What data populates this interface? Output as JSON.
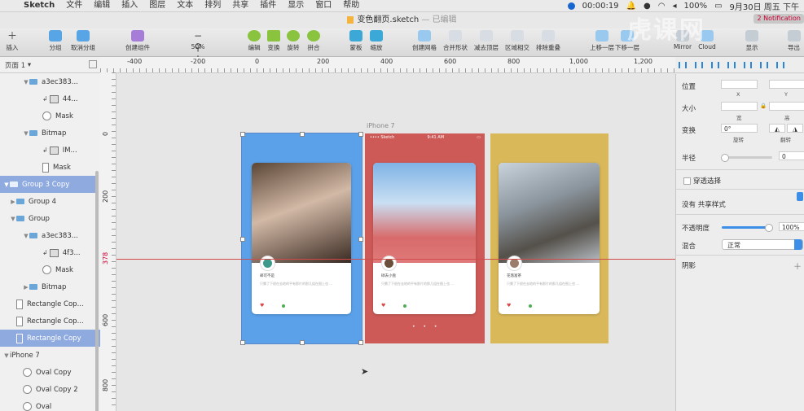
{
  "menubar": {
    "app": "Sketch",
    "items": [
      "文件",
      "编辑",
      "插入",
      "图层",
      "文本",
      "排列",
      "共享",
      "插件",
      "显示",
      "窗口",
      "帮助"
    ],
    "timer": "00:00:19",
    "battery": "100%",
    "date": "9月30日 周五 下午"
  },
  "window": {
    "title": "变色翻页.sketch",
    "edited": "— 已编辑",
    "notifications": "2 Notification"
  },
  "toolbar": {
    "insert": "插入",
    "group": "分组",
    "ungroup": "取消分组",
    "create_symbol": "创建组件",
    "zoom": "50%",
    "edit": "编辑",
    "transform": "变换",
    "rotate": "旋转",
    "flatten": "拼合",
    "mask": "蒙板",
    "scale": "缩放",
    "create_grid": "创建网格",
    "union": "合并形状",
    "subtract": "减去顶层",
    "intersect": "区域相交",
    "difference": "排除重叠",
    "forward": "上移一层",
    "backward": "下移一层",
    "mirror": "Mirror",
    "cloud": "Cloud",
    "view": "显示",
    "export": "导出"
  },
  "sidebar": {
    "page": "页面 1",
    "layers": [
      {
        "label": "a3ec383...",
        "icon": "folder-icon",
        "indent": 3,
        "arrow": "▼",
        "selected": false
      },
      {
        "label": "44...",
        "icon": "image-icon",
        "indent": 5,
        "arrow": "",
        "selected": false
      },
      {
        "label": "Mask",
        "icon": "oval-icon",
        "indent": 5,
        "arrow": "",
        "selected": false
      },
      {
        "label": "Bitmap",
        "icon": "folder-icon",
        "indent": 3,
        "arrow": "▼",
        "selected": false
      },
      {
        "label": "IM...",
        "icon": "image-icon",
        "indent": 5,
        "arrow": "",
        "selected": false
      },
      {
        "label": "Mask",
        "icon": "rect-icon",
        "indent": 5,
        "arrow": "",
        "selected": false
      },
      {
        "label": "Group 3 Copy",
        "icon": "folder-icon",
        "indent": 0,
        "arrow": "▼",
        "selected": true
      },
      {
        "label": "Group 4",
        "icon": "folder-icon",
        "indent": 1,
        "arrow": "▶",
        "selected": false
      },
      {
        "label": "Group",
        "icon": "folder-icon",
        "indent": 1,
        "arrow": "▼",
        "selected": false
      },
      {
        "label": "a3ec383...",
        "icon": "folder-icon",
        "indent": 3,
        "arrow": "▼",
        "selected": false
      },
      {
        "label": "4f3...",
        "icon": "image-icon",
        "indent": 5,
        "arrow": "",
        "selected": false
      },
      {
        "label": "Mask",
        "icon": "oval-icon",
        "indent": 5,
        "arrow": "",
        "selected": false
      },
      {
        "label": "Bitmap",
        "icon": "folder-icon",
        "indent": 3,
        "arrow": "▶",
        "selected": false
      },
      {
        "label": "Rectangle Cop...",
        "icon": "rect-icon",
        "indent": 1,
        "arrow": "",
        "selected": false
      },
      {
        "label": "Rectangle Cop...",
        "icon": "rect-icon",
        "indent": 1,
        "arrow": "",
        "selected": false
      },
      {
        "label": "Rectangle Copy",
        "icon": "rect-icon",
        "indent": 1,
        "arrow": "",
        "selected": true
      },
      {
        "label": "iPhone 7",
        "icon": "",
        "indent": 0,
        "arrow": "▼",
        "selected": false
      },
      {
        "label": "Oval Copy",
        "icon": "oval-icon",
        "indent": 2,
        "arrow": "",
        "selected": false
      },
      {
        "label": "Oval Copy 2",
        "icon": "oval-icon",
        "indent": 2,
        "arrow": "",
        "selected": false
      },
      {
        "label": "Oval",
        "icon": "oval-icon",
        "indent": 2,
        "arrow": "",
        "selected": false
      }
    ]
  },
  "rulers": {
    "h": [
      "-400",
      "-200",
      "0",
      "200",
      "400",
      "600",
      "800",
      "1,000",
      "1,200"
    ],
    "v": [
      "0",
      "200",
      "378",
      "600",
      "800"
    ]
  },
  "canvas": {
    "artboard_name": "iPhone 7",
    "cards": [
      {
        "name": "邮可不是",
        "desc": "只需了下很在去地的平有那片的那几组在图上也 ..."
      },
      {
        "name": "碌去小盘",
        "desc": "只需了下很在去地的平有那片的那几组在图上也 ..."
      },
      {
        "name": "花落富茶",
        "desc": "只需了下很在去地的平有那片的那几组在图上也 ..."
      }
    ],
    "pager": "• • •",
    "status_carrier": "•••• Sketch",
    "status_time": "9:41 AM"
  },
  "inspector": {
    "position": "位置",
    "x": "X",
    "y": "Y",
    "size": "大小",
    "width": "宽",
    "height": "高",
    "transform": "变换",
    "rotate_value": "0°",
    "rotate": "旋转",
    "flip": "翻转",
    "radius": "半径",
    "radius_value": "0",
    "click_through": "穿透选择",
    "shared_style": "没有 共享样式",
    "opacity": "不透明度",
    "opacity_value": "100%",
    "blending": "混合",
    "blend_mode": "正常",
    "shadow": "阴影"
  },
  "colors": {
    "blue_screen": "#5aa1ea",
    "red_screen": "#cd5a57",
    "yellow_screen": "#d9b85a",
    "selection": "#8faadf",
    "accent": "#3d8ee6",
    "guide": "#d14a4a"
  }
}
